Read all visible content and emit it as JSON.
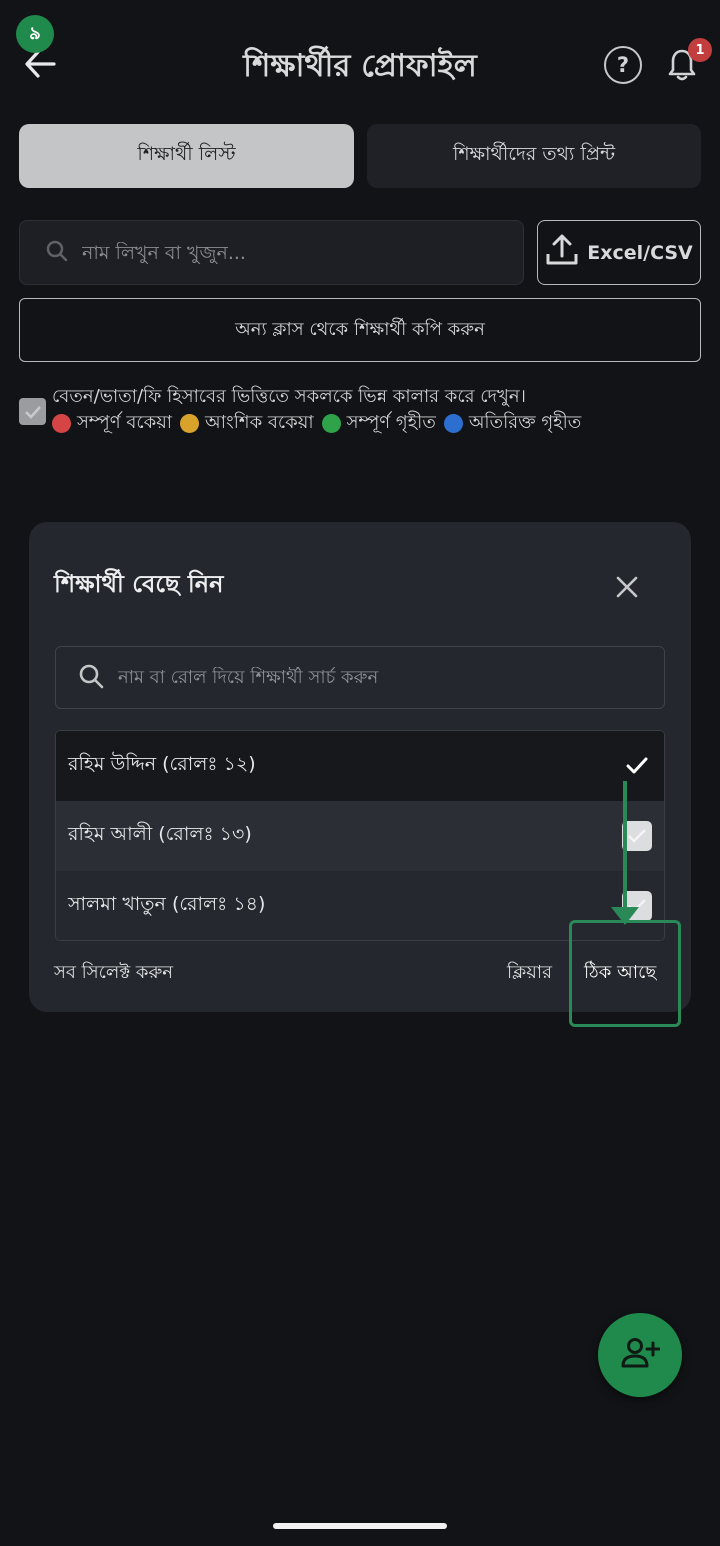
{
  "header": {
    "step_badge": "৯",
    "title": "শিক্ষার্থীর প্রোফাইল",
    "help_label": "?",
    "notification_count": "1"
  },
  "tabs": [
    {
      "label": "শিক্ষার্থী লিস্ট",
      "active": true
    },
    {
      "label": "শিক্ষার্থীদের তথ্য প্রিন্ট",
      "active": false
    }
  ],
  "search": {
    "placeholder": "নাম লিখুন বা খুজুন...",
    "value": ""
  },
  "upload": {
    "label": "Excel/CSV"
  },
  "copy_button": {
    "label": "অন্য ক্লাস থেকে শিক্ষার্থী কপি করুন"
  },
  "color_legend": {
    "checked": true,
    "description": "বেতন/ভাতা/ফি হিসাবের ভিত্তিতে সকলকে ভিন্ন কালার করে দেখুন।",
    "items": [
      {
        "label": "সম্পূর্ণ বকেয়া",
        "color": "#d64545"
      },
      {
        "label": "আংশিক বকেয়া",
        "color": "#d9a22b"
      },
      {
        "label": "সম্পূর্ণ গৃহীত",
        "color": "#2fa34a"
      },
      {
        "label": "অতিরিক্ত গৃহীত",
        "color": "#2d6fd0"
      }
    ]
  },
  "modal": {
    "title": "শিক্ষার্থী বেছে নিন",
    "search_placeholder": "নাম বা রোল দিয়ে শিক্ষার্থী সার্চ করুন",
    "students": [
      {
        "label": "রহিম উদ্দিন (রোলঃ ১২)",
        "selected": true
      },
      {
        "label": "রহিম আলী (রোলঃ ১৩)",
        "selected": false
      },
      {
        "label": "সালমা খাতুন (রোলঃ ১৪)",
        "selected": false
      }
    ],
    "select_all_label": "সব সিলেক্ট করুন",
    "clear_label": "ক্লিয়ার",
    "ok_label": "ঠিক আছে"
  },
  "colors": {
    "background": "#121316",
    "accent_green": "#1f8a4c",
    "modal_bg": "#24272d"
  }
}
